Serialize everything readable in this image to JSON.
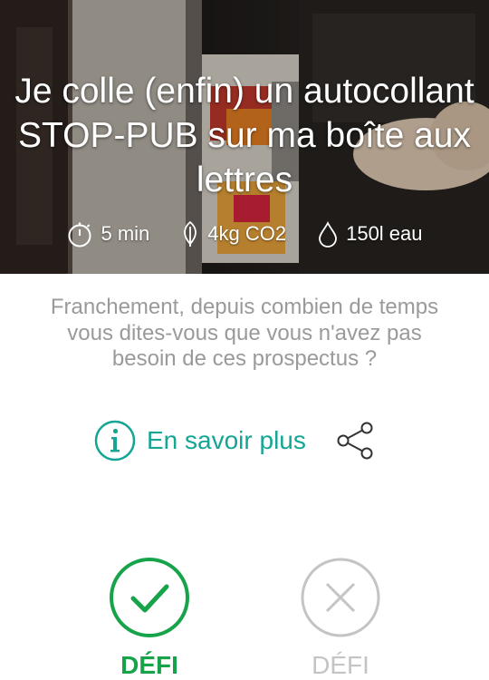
{
  "challenge": {
    "title": "Je colle (enfin) un autocollant STOP-PUB sur ma boîte aux lettres",
    "stats": {
      "duration": "5 min",
      "co2": "4kg CO2",
      "water": "150l eau"
    },
    "description": "Franchement, depuis combien de temps vous dites-vous que vous n'avez pas besoin de ces prospectus ?",
    "info_label": "En savoir plus"
  },
  "actions": {
    "accept_label": "DÉFI",
    "decline_label": "DÉFI"
  },
  "icons": {
    "duration": "stopwatch-icon",
    "co2": "leaf-icon",
    "water": "water-drop-icon",
    "info": "info-icon",
    "share": "share-icon",
    "accept": "check-icon",
    "decline": "close-icon"
  },
  "colors": {
    "accent_teal": "#15a595",
    "accept_green": "#16a34a",
    "decline_grey": "#c4c4c4",
    "body_text": "#9a9a9a"
  }
}
